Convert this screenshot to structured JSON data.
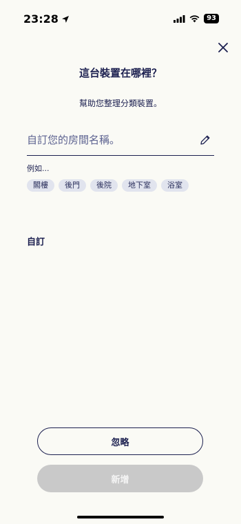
{
  "status": {
    "time": "23:28",
    "battery": "93"
  },
  "header": {
    "title": "這台裝置在哪裡？",
    "subtitle": "幫助您整理分類裝置。"
  },
  "input": {
    "placeholder": "自訂您的房間名稱。",
    "value": ""
  },
  "examples": {
    "label": "例如...",
    "chips": [
      "閣樓",
      "後門",
      "後院",
      "地下室",
      "浴室"
    ]
  },
  "custom": {
    "label": "自訂"
  },
  "buttons": {
    "skip": "忽略",
    "add": "新增"
  },
  "colors": {
    "primary": "#1B1F4F",
    "background": "#FAFAF5",
    "chip": "#E1E4EE",
    "disabled": "#C9C9C9"
  },
  "icons": [
    "location-arrow-icon",
    "cellular-signal-icon",
    "wifi-icon",
    "battery-icon",
    "close-icon",
    "pencil-icon"
  ]
}
